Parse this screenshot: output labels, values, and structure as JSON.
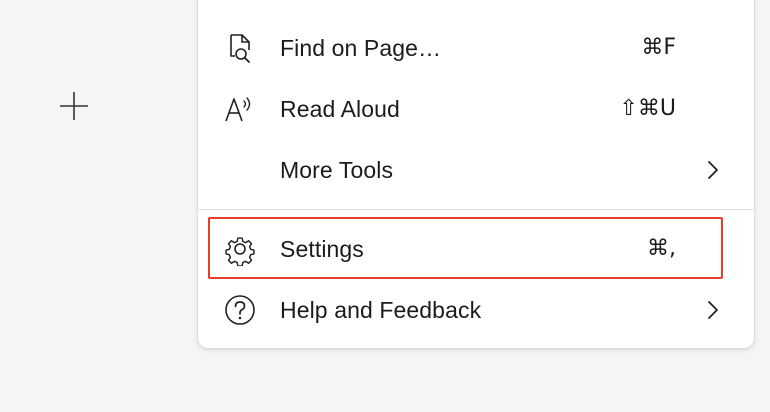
{
  "menu": {
    "items": [
      {
        "label": "Find on Page…",
        "shortcut": "⌘F",
        "icon": "find-on-page-icon"
      },
      {
        "label": "Read Aloud",
        "shortcut": "⇧⌘U",
        "icon": "read-aloud-icon"
      },
      {
        "label": "More Tools",
        "shortcut": "",
        "icon": "",
        "submenu": true
      },
      {
        "label": "Settings",
        "shortcut": "⌘,",
        "icon": "gear-icon",
        "highlighted": true
      },
      {
        "label": "Help and Feedback",
        "shortcut": "",
        "icon": "help-icon",
        "submenu": true
      }
    ]
  },
  "colors": {
    "highlight": "#e2412a",
    "menu_background": "#ffffff",
    "page_background": "#f5f5f5",
    "text": "#1b1b1b"
  }
}
